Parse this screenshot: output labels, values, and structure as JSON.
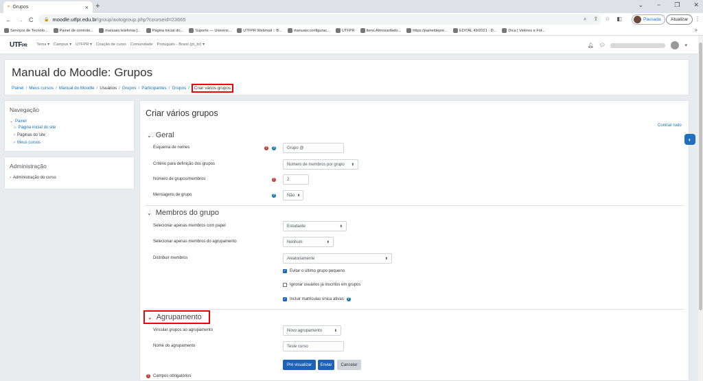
{
  "browser": {
    "tab_title": "Grupos",
    "tab_close": "×",
    "new_tab": "+",
    "window_controls": [
      "⌄",
      "−",
      "❐",
      "✕"
    ],
    "nav": {
      "back": "←",
      "forward": "→",
      "reload": "C"
    },
    "url_host": "moodle.utfpr.edu.br",
    "url_path": "/group/autogroup.php?courseid=23665",
    "profile_label": "Pausada",
    "update_label": "Atualizar",
    "bookmarks": [
      "Serviços de Tecnolo...",
      "Painel de controle...",
      "manuais:telefonia [...",
      "Página inicial do...",
      "Suporte — Universi...",
      "UTFPR Webmail :: B...",
      "manuais:configurac...",
      "UTFPR",
      "Itens Almoxarifado...",
      "https://paineldepre...",
      "EDITAL 49/2021 - D...",
      "Dica | Vetores e Fot..."
    ],
    "bookmarks_more": "»"
  },
  "moodle_nav": {
    "logo": "UTF",
    "logo_suffix": "PR",
    "menu": [
      "Tema ▾",
      "Campus ▾",
      "UTFPR ▾",
      "Criação de curso",
      "Comunidade",
      "Português - Brasil (pt_br) ▾"
    ]
  },
  "header": {
    "title": "Manual do Moodle: Grupos",
    "breadcrumb": [
      "Painel",
      "Meus cursos",
      "Manual do Moodle",
      "Usuários",
      "Grupos",
      "Participantes",
      "Grupos"
    ],
    "breadcrumb_current": "Criar vários grupos",
    "separator": "/"
  },
  "nav_block": {
    "title": "Navegação",
    "items": [
      "Painel",
      "Página inicial do site",
      "Páginas do site",
      "Meus cursos"
    ]
  },
  "admin_block": {
    "title": "Administração",
    "items": [
      "Administração do curso"
    ]
  },
  "main": {
    "title": "Criar vários grupos",
    "collapse_all": "Contrair tudo",
    "sections": {
      "geral": "Geral",
      "membros": "Membros do grupo",
      "agrupamento": "Agrupamento"
    },
    "fields": {
      "esquema_label": "Esquema de nomes",
      "esquema_value": "Grupo @",
      "criterio_label": "Critério para definição dos grupos",
      "criterio_value": "Número de membros por grupo",
      "numero_label": "Número de grupos/membros",
      "numero_value": "2",
      "mensagens_label": "Mensagens de grupo",
      "mensagens_value": "Não",
      "papel_label": "Selecionar apenas membros com papel",
      "papel_value": "Estudante",
      "agrupamento_sel_label": "Selecionar apenas membros do agrupamento",
      "agrupamento_sel_value": "Nenhum",
      "distribuir_label": "Distribuir membros",
      "distribuir_value": "Aleatoriamente",
      "evitar_label": "Evitar o último grupo pequeno",
      "ignorar_label": "Ignorar usuários já inscritos em grupos",
      "incluir_label": "Incluir matrículas única ativas",
      "vincular_label": "Vincular grupos ao agrupamento",
      "vincular_value": "Novo agrupamento",
      "nome_agrup_label": "Nome do agrupamento",
      "nome_agrup_value": "Teste curso"
    },
    "buttons": {
      "preview": "Pré visualizar",
      "submit": "Enviar",
      "cancel": "Cancelar"
    },
    "required_note": "Campos obrigatórios"
  }
}
